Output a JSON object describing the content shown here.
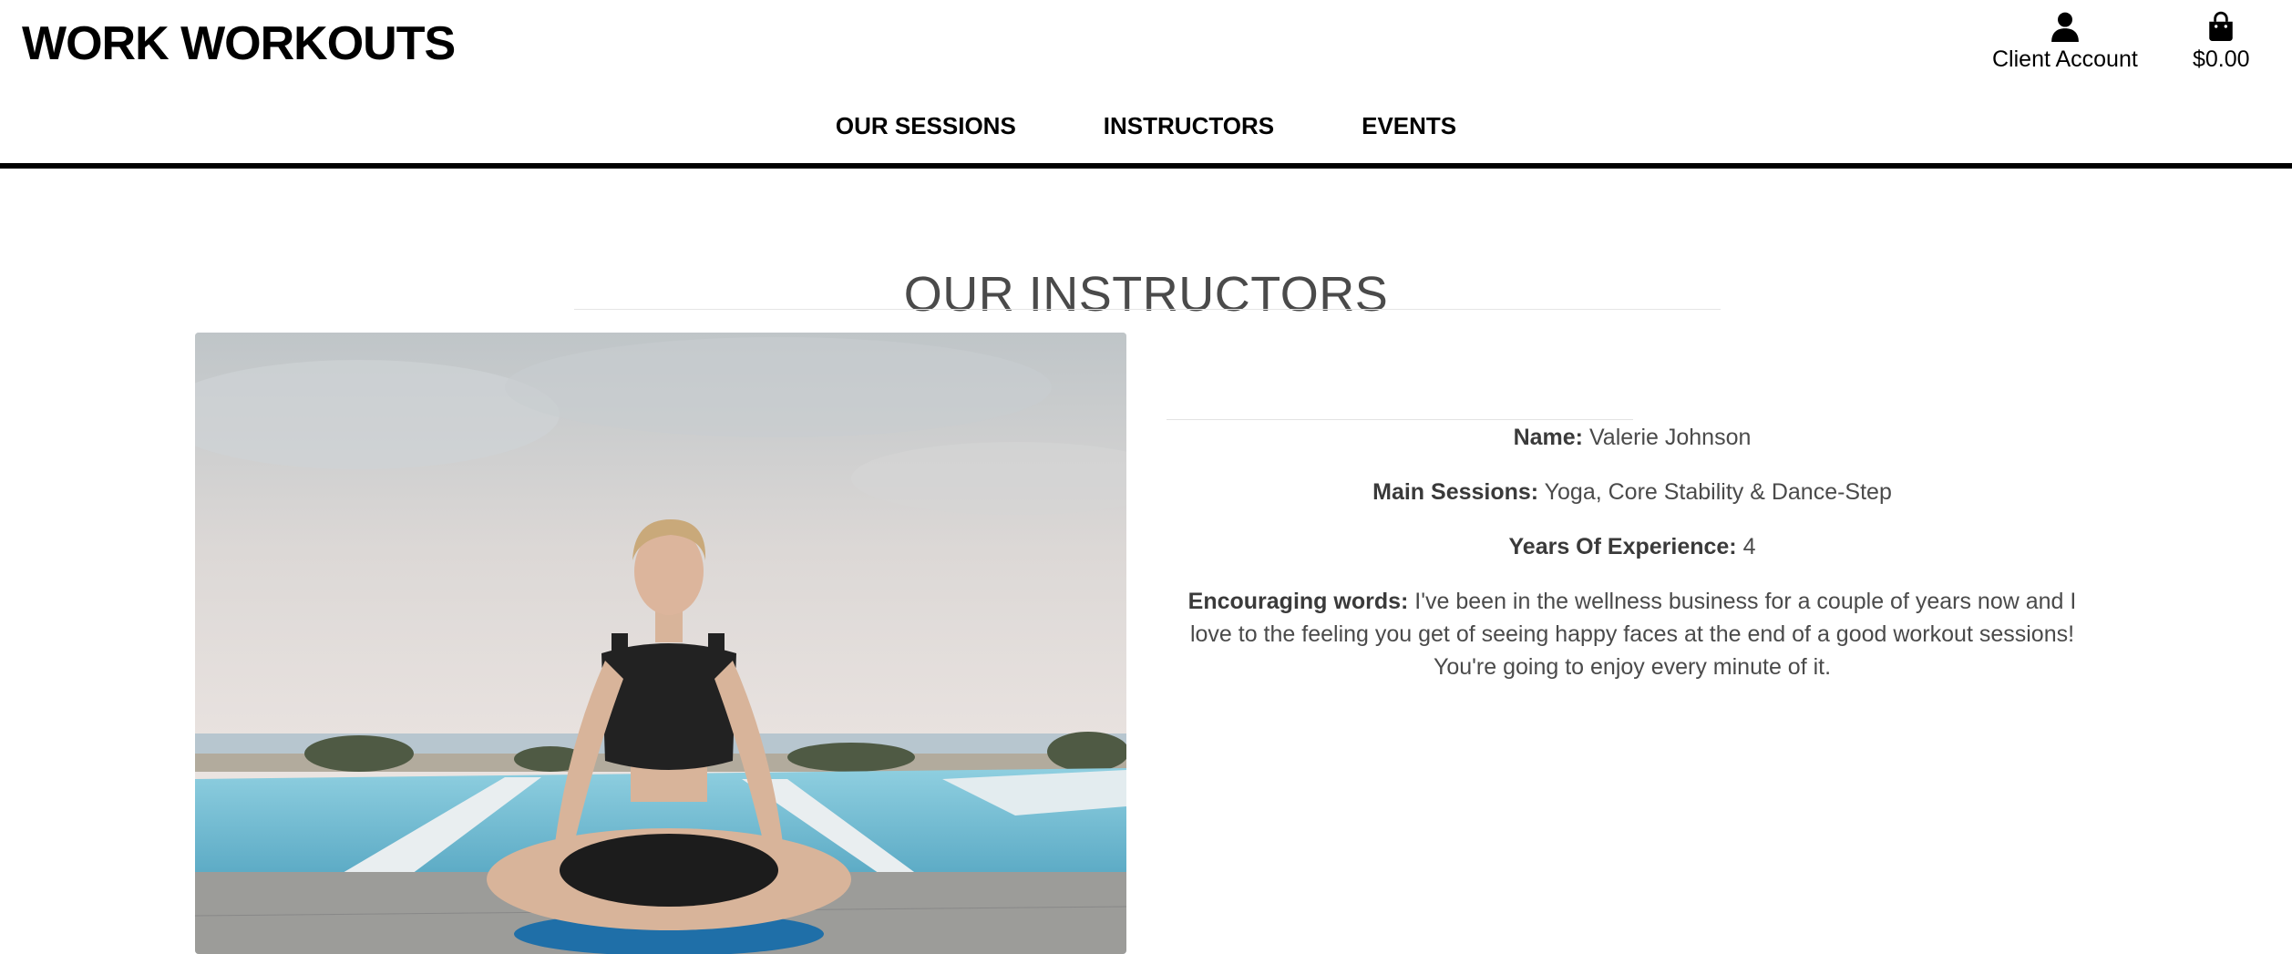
{
  "header": {
    "logo": "WORK WORKOUTS",
    "account_label": "Client Account",
    "bag_total": "$0.00"
  },
  "nav": {
    "items": [
      {
        "label": "OUR SESSIONS"
      },
      {
        "label": "INSTRUCTORS"
      },
      {
        "label": "EVENTS"
      }
    ]
  },
  "page": {
    "title": "OUR INSTRUCTORS"
  },
  "instructor": {
    "photo_icon": "yoga-instructor-photo",
    "name_label": "Name:",
    "name": "Valerie Johnson",
    "sessions_label": "Main Sessions:",
    "sessions": "Yoga, Core Stability & Dance-Step",
    "experience_label": "Years Of Experience:",
    "experience": "4",
    "quote_label": "Encouraging words:",
    "quote": "I've been in the wellness business for a couple of years now and I love to the feeling you get of seeing happy faces at the end of a good workout sessions! You're going to enjoy every minute of it."
  },
  "colors": {
    "text_muted": "#4a4a4a",
    "rule": "#000000",
    "pool": "#7fc1d6"
  },
  "icons": {
    "account": "user-icon",
    "bag": "shopping-bag-icon"
  }
}
